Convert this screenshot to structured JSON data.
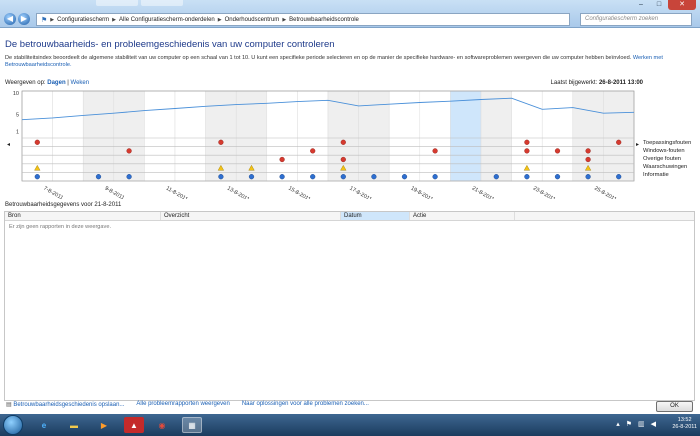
{
  "window": {
    "minimize": "–",
    "maximize": "□",
    "close": "✕"
  },
  "address": {
    "crumbs": [
      "Configuratiescherm",
      "Alle Configuratiescherm-onderdelen",
      "Onderhoudscentrum",
      "Betrouwbaarheidscontrole"
    ],
    "search_placeholder": "Configuratiescherm zoeken"
  },
  "page": {
    "title": "De betrouwbaarheids- en probleemgeschiedenis van uw computer controleren",
    "description": "De stabiliteitsindex beoordeelt de algemene stabiliteit van uw computer op een schaal van 1 tot 10. U kunt een specifieke periode selecteren en op de manier de specifieke hardware- en softwareproblemen weergeven die uw computer hebben beïnvloed.",
    "description_link": "Werken met Betrouwbaarheidscontrole.",
    "view_label": "Weergeven op:",
    "view_days": "Dagen",
    "view_sep": "|",
    "view_weeks": "Weken",
    "last_updated_label": "Laatst bijgewerkt:",
    "last_updated_value": "26-8-2011 13:00"
  },
  "chart_data": {
    "type": "line",
    "title": "",
    "ylabel": "",
    "xlabel": "",
    "ylim": [
      0,
      10
    ],
    "y_ticks": [
      "10",
      "5",
      "1"
    ],
    "x_tick_labels": [
      "7-8-2011",
      "9-8-2011",
      "11-8-2011",
      "13-8-2011",
      "15-8-2011",
      "17-8-2011",
      "19-8-2011",
      "21-8-2011",
      "23-8-2011",
      "25-8-2011"
    ],
    "days": 20,
    "selected_day_index": 14,
    "stability_index": [
      3.8,
      4.2,
      4.8,
      5.3,
      5.9,
      6.4,
      6.9,
      7.3,
      7.6,
      8.0,
      8.3,
      7.0,
      7.4,
      7.8,
      8.1,
      8.5,
      8.8,
      6.2,
      6.6,
      5.3,
      5.5
    ],
    "event_rows": [
      "Toepassingsfouten",
      "Windows-fouten",
      "Overige fouten",
      "Waarschuwingen",
      "Informatie"
    ],
    "events": [
      {
        "row": 0,
        "days": [
          0,
          6,
          10,
          16,
          19
        ]
      },
      {
        "row": 1,
        "days": [
          3,
          9,
          13,
          16,
          17,
          18
        ]
      },
      {
        "row": 2,
        "days": [
          8,
          10,
          18
        ]
      },
      {
        "row": 3,
        "days": [
          0,
          6,
          7,
          10,
          16,
          18
        ]
      },
      {
        "row": 4,
        "days": [
          0,
          2,
          3,
          6,
          7,
          8,
          9,
          10,
          11,
          12,
          13,
          15,
          16,
          17,
          18,
          19
        ]
      }
    ],
    "colors": {
      "line": "#4a90d9",
      "selected": "#cfe6fb",
      "shade": "#efefef",
      "error": "#d63a2f",
      "warning": "#f2c218",
      "info": "#2e6fd0"
    }
  },
  "details": {
    "title": "Betrouwbaarheidsgegevens voor 21-8-2011",
    "columns": [
      "Bron",
      "Overzicht",
      "Datum",
      "Actie"
    ],
    "empty_message": "Er zijn geen rapporten in deze weergave."
  },
  "links": {
    "save": "Betrouwbaarheidsgeschiedenis opslaan...",
    "all_reports": "Alle probleemrapporten weergeven",
    "solutions": "Naar oplossingen voor alle problemen zoeken..."
  },
  "ok_button": "OK",
  "taskbar": {
    "time": "13:52",
    "date": "26-8-2011"
  }
}
